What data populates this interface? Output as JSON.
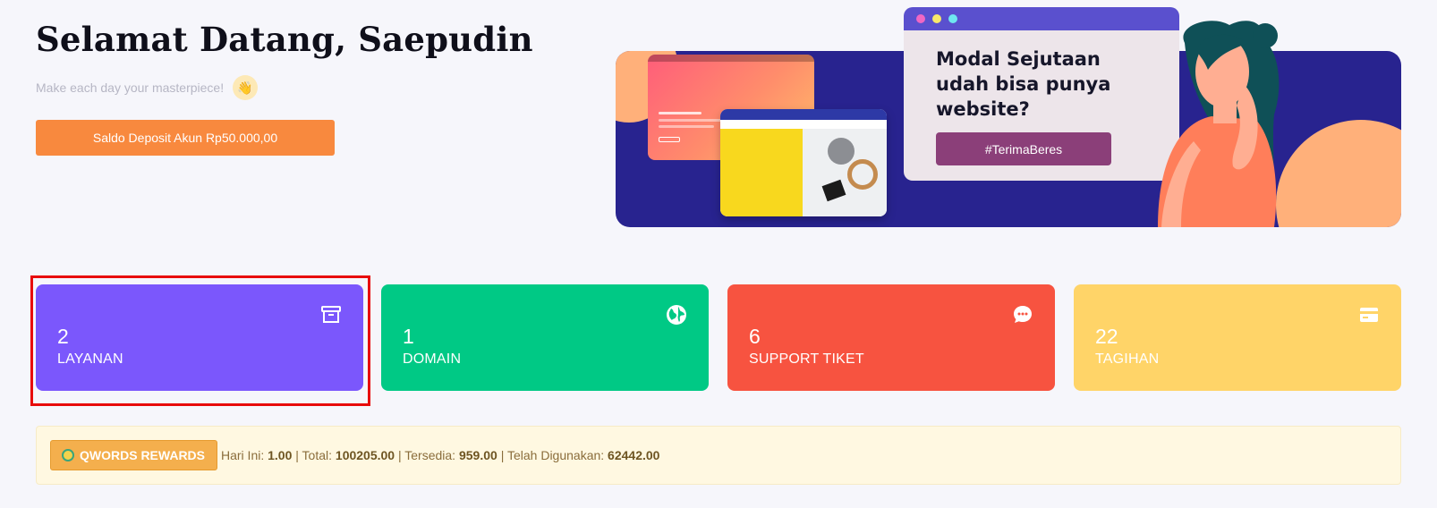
{
  "header": {
    "title": "Selamat Datang, Saepudin",
    "subtitle": "Make each day your masterpiece!",
    "subtitle_emoji": "👋",
    "deposit_button": "Saldo Deposit Akun Rp50.000,00"
  },
  "banner": {
    "headline_line1": "Modal Sejutaan",
    "headline_line2": "udah bisa punya",
    "headline_line3": "website?",
    "tag": "#TerimaBeres"
  },
  "cards": [
    {
      "count": "2",
      "label": "LAYANAN",
      "icon": "archive-icon",
      "color": "#7b57fc"
    },
    {
      "count": "1",
      "label": "DOMAIN",
      "icon": "globe-icon",
      "color": "#00c985"
    },
    {
      "count": "6",
      "label": "SUPPORT TIKET",
      "icon": "chat-icon",
      "color": "#f75340"
    },
    {
      "count": "22",
      "label": "TAGIHAN",
      "icon": "credit-card-icon",
      "color": "#ffd468"
    }
  ],
  "rewards": {
    "button_label": "QWORDS REWARDS",
    "today_label": "Hari Ini:",
    "today_value": "1.00",
    "total_label": "Total:",
    "total_value": "100205.00",
    "available_label": "Tersedia:",
    "available_value": "959.00",
    "used_label": "Telah Digunakan:",
    "used_value": "62442.00"
  }
}
